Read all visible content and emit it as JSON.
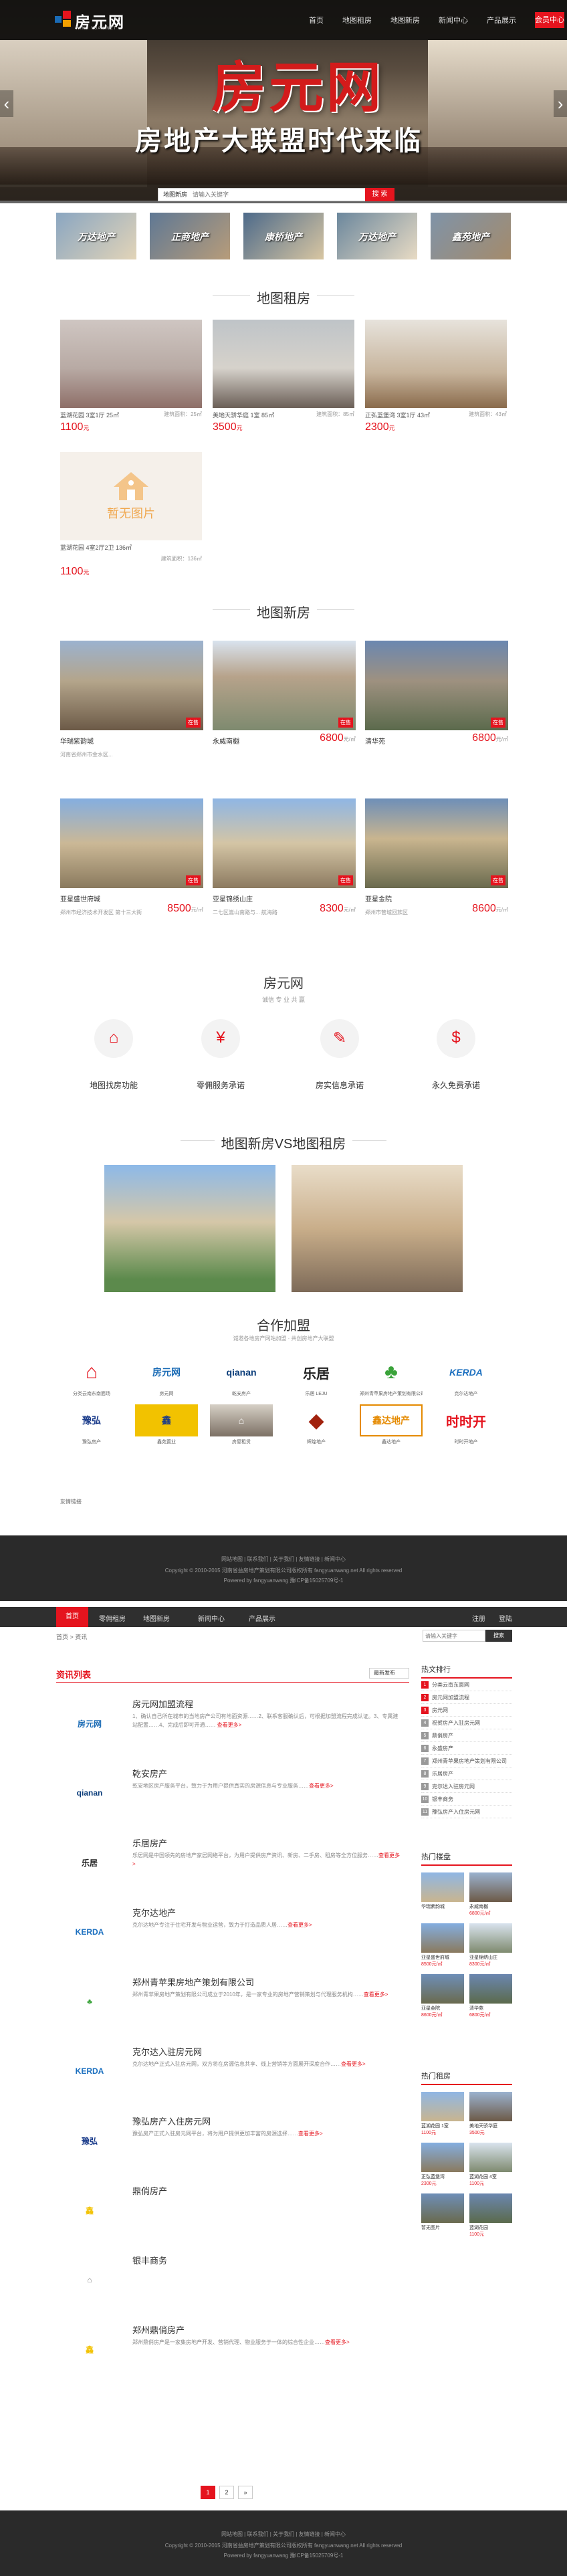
{
  "nav": {
    "logo_text": "房元网",
    "logo_sub": "FANG YUAN.NET",
    "links": [
      "首页",
      "地图租房",
      "地图新房",
      "新闻中心",
      "产品展示"
    ],
    "button": "会员中心"
  },
  "hero": {
    "title": "房元网",
    "subtitle": "房地产大联盟时代来临"
  },
  "search": {
    "label": "地图新房",
    "placeholder": "请输入关键字",
    "button": "搜 索"
  },
  "categories": [
    "万达地产",
    "正商地产",
    "康桥地产",
    "万达地产",
    "鑫苑地产"
  ],
  "rent_section": {
    "title": "地图租房",
    "items": [
      {
        "name": "蓝湖花园 3室1厅 25㎡",
        "area": "建筑面积：25㎡",
        "price": "1100",
        "unit": "元"
      },
      {
        "name": "美地天骄华庭 1室 85㎡",
        "area": "建筑面积：85㎡",
        "price": "3500",
        "unit": "元"
      },
      {
        "name": "正弘蓝堡湾 3室1厅 43㎡",
        "area": "建筑面积：43㎡",
        "price": "2300",
        "unit": "元"
      },
      {
        "name": "蓝湖花园 4室2厅2卫 136㎡",
        "area": "建筑面积：136㎡",
        "price": "1100",
        "unit": "元"
      }
    ],
    "placeholder_text": "暂无图片"
  },
  "new_section": {
    "title": "地图新房",
    "items": [
      {
        "name": "华瑞紫韵城",
        "addr": "河南省郑州市金水区...",
        "price": "",
        "tag": "在售"
      },
      {
        "name": "永威南樾",
        "addr": "",
        "price": "6800",
        "unit": "元/㎡",
        "tag": "在售"
      },
      {
        "name": "清华苑",
        "addr": "",
        "price": "6800",
        "unit": "元/㎡",
        "tag": "在售"
      },
      {
        "name": "亚星盛世府城",
        "addr": "郑州市经济技术开发区 第十三大街",
        "price": "8500",
        "unit": "元/㎡",
        "tag": "在售"
      },
      {
        "name": "亚星锦绣山庄",
        "addr": "二七区嵩山南路与... 航海路",
        "price": "8300",
        "unit": "元/㎡",
        "tag": "在售"
      },
      {
        "name": "亚星金院",
        "addr": "郑州市管城回族区",
        "price": "8600",
        "unit": "元/㎡",
        "tag": "在售"
      }
    ]
  },
  "about": {
    "title": "房元网",
    "sub": "诚信 专 业 共 赢",
    "features": [
      {
        "icon": "house-icon",
        "glyph": "⌂",
        "label": "地图找房功能"
      },
      {
        "icon": "money-icon",
        "glyph": "¥",
        "label": "零佣服务承诺"
      },
      {
        "icon": "check-icon",
        "glyph": "✎",
        "label": "房实信息承诺"
      },
      {
        "icon": "free-icon",
        "glyph": "$",
        "label": "永久免费承诺"
      }
    ]
  },
  "compare_title": "地图新房VS地图租房",
  "partners": {
    "title": "合作加盟",
    "sub": "诚邀各地房产网站加盟 · 共创房地产大联盟",
    "logos": [
      {
        "text": "⌂",
        "cap": "分类云南东南面场",
        "color": "#e5141e"
      },
      {
        "text": "房元网",
        "cap": "房元网",
        "color": "#1a6bb5"
      },
      {
        "text": "qianan",
        "cap": "乾安房产",
        "color": "#0b3d7a"
      },
      {
        "text": "乐居",
        "cap": "乐居 LEJU",
        "color": "#222"
      },
      {
        "text": "♣",
        "cap": "郑州青苹果房地产策划有限公司",
        "color": "#3aa33a"
      },
      {
        "text": "KERDA",
        "cap": "克尔达地产",
        "color": "#1b6fbf"
      },
      {
        "text": "豫弘",
        "cap": "豫弘房产",
        "color": "#1a3b8a"
      },
      {
        "text": "鑫",
        "cap": "鑫苑置业",
        "color": "#f2c200"
      },
      {
        "text": "⌂",
        "cap": "房屋租赁",
        "color": "#888"
      },
      {
        "text": "◆",
        "cap": "辉煌地产",
        "color": "#a1220e"
      },
      {
        "text": "鑫达地产",
        "cap": "鑫达地产",
        "color": "#e58a00"
      },
      {
        "text": "时时开",
        "cap": "时时开地产",
        "color": "#e5141e"
      }
    ],
    "more": "友情链接"
  },
  "footer1": {
    "links": "网站地图 | 联系我们 | 关于我们 | 友情链接 | 新闻中心",
    "copyright": "Copyright © 2010-2015 河南省益房地产策划有限公司版权所有 fangyuanwang.net All rights reserved",
    "icp": "Powered by fangyuanwang 豫ICP备15025709号-1"
  },
  "page2": {
    "nav": [
      "首页",
      "零佣租房",
      "地图新房",
      "新闻中心",
      "产品展示"
    ],
    "nav_right": [
      "注册",
      "登陆"
    ],
    "crumb": "首页 > 资讯",
    "search_placeholder": "请输入关键字",
    "search_button": "搜索",
    "list_title": "资讯列表",
    "sort": "最新发布",
    "news": [
      {
        "title": "房元网加盟流程",
        "logo": "房元网",
        "logo_color": "#1a6bb5",
        "desc": "1、确认自己所在城市的当地房产公司有地面资源……2、联系客服确认后，可根据加盟流程完成认证。3、专属建站配置……4、完成后即可开通…… ",
        "more": "查看更多>"
      },
      {
        "title": "乾安房产",
        "logo": "qianan",
        "logo_color": "#0b3d7a",
        "desc": "乾安地区房产服务平台，致力于为用户提供真实的房源信息与专业服务……",
        "more": "查看更多>"
      },
      {
        "title": "乐居房产",
        "logo": "乐居",
        "logo_color": "#222",
        "desc": "乐居网是中国领先的房地产家居网络平台，为用户提供房产资讯、新房、二手房、租房等全方位服务……",
        "more": "查看更多>"
      },
      {
        "title": "克尔达地产",
        "logo": "KERDA",
        "logo_color": "#1b6fbf",
        "desc": "克尔达地产专注于住宅开发与物业运营，致力于打造品质人居……",
        "more": "查看更多>"
      },
      {
        "title": "郑州青苹果房地产策划有限公司",
        "logo": "♣",
        "logo_color": "#3aa33a",
        "desc": "郑州青苹果房地产策划有限公司成立于2010年，是一家专业的房地产营销策划与代理服务机构……",
        "more": "查看更多>"
      },
      {
        "title": "克尔达入驻房元网",
        "logo": "KERDA",
        "logo_color": "#1b6fbf",
        "desc": "克尔达地产正式入驻房元网，双方将在房源信息共享、线上营销等方面展开深度合作……",
        "more": "查看更多>"
      },
      {
        "title": "豫弘房产入住房元网",
        "logo": "豫弘",
        "logo_color": "#1a3b8a",
        "desc": "豫弘房产正式入驻房元网平台，将为用户提供更加丰富的房源选择……",
        "more": "查看更多>"
      },
      {
        "title": "鼎俏房产",
        "logo": "鑫",
        "logo_color": "#f2c200",
        "desc": "",
        "more": ""
      },
      {
        "title": "银丰商务",
        "logo": "⌂",
        "logo_color": "#888",
        "desc": "",
        "more": ""
      },
      {
        "title": "郑州鼎俏房产",
        "logo": "鑫",
        "logo_color": "#f2c200",
        "desc": "郑州鼎俏房产是一家集房地产开发、营销代理、物业服务于一体的综合性企业……",
        "more": "查看更多>"
      }
    ],
    "pager": [
      "1",
      "2",
      "»"
    ],
    "side_rank_title": "热文排行",
    "rank": [
      "分类云南东面网",
      "房元网加盟流程",
      "房元网",
      "祝贺房产入驻房元网",
      "鼎俏房产",
      "永盛房产",
      "郑州青苹果房地产策划有限公司",
      "乐居房产",
      "克尔达入驻房元网",
      "银丰商务",
      "豫弘房产入住房元网"
    ],
    "side_hot_title": "热门楼盘",
    "hot_new": [
      {
        "name": "华瑞紫韵城",
        "price": ""
      },
      {
        "name": "永威南樾",
        "price": "6800元/㎡"
      },
      {
        "name": "亚星盛世府城",
        "price": "8500元/㎡"
      },
      {
        "name": "亚星锦绣山庄",
        "price": "8300元/㎡"
      },
      {
        "name": "亚星金院",
        "price": "8600元/㎡"
      },
      {
        "name": "清华苑",
        "price": "6800元/㎡"
      }
    ],
    "side_rent_title": "热门租房",
    "hot_rent": [
      {
        "name": "蓝湖花园 1室",
        "price": "1100元"
      },
      {
        "name": "美地天骄华庭",
        "price": "3500元"
      },
      {
        "name": "正弘蓝堡湾",
        "price": "2300元"
      },
      {
        "name": "蓝湖花园 4室",
        "price": "1100元"
      },
      {
        "name": "暂无图片",
        "price": ""
      },
      {
        "name": "蓝湖花园",
        "price": "1100元"
      }
    ]
  },
  "footer2": {
    "links": "网站地图 | 联系我们 | 关于我们 | 友情链接 | 新闻中心",
    "copyright": "Copyright © 2010-2015 河南省益房地产策划有限公司版权所有 fangyuanwang.net All rights reserved",
    "icp": "Powered by fangyuanwang 豫ICP备15025709号-1"
  },
  "colors": {
    "accent": "#e5141e",
    "dark": "#2a2a2a"
  }
}
